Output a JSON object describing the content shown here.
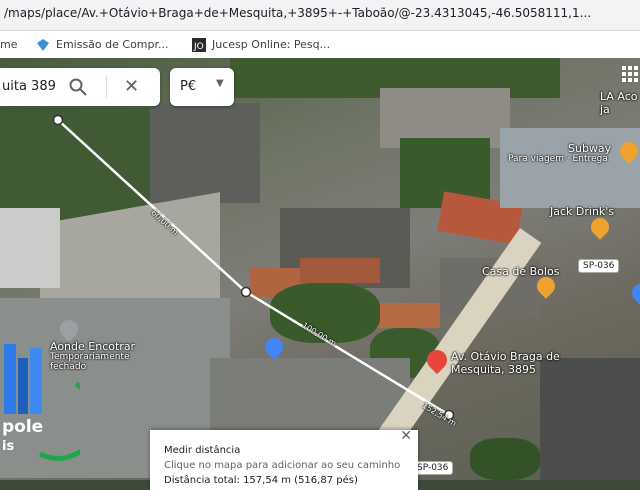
{
  "browser": {
    "url": "/maps/place/Av.+Otávio+Braga+de+Mesquita,+3895+-+Taboão/@-23.4313045,-46.5058111,1...",
    "bookmarks": [
      {
        "label": "me"
      },
      {
        "label": "Emissão de Compr..."
      },
      {
        "label": "Jucesp Online: Pesq..."
      }
    ]
  },
  "search": {
    "value": "uita 389",
    "filter_label": "P€"
  },
  "places": [
    {
      "label": "LA Aco",
      "label2": "ja"
    },
    {
      "label": "Subway",
      "sub": "Para viagem · Entrega"
    },
    {
      "label": "Jack Drink's"
    },
    {
      "label": "Casa de Bolos"
    },
    {
      "label": "Aonde Encotrar",
      "sub": "Temporariamente",
      "sub2": "fechado"
    },
    {
      "label": "Av. Otávio Braga de",
      "label2": "Mesquita, 3895"
    }
  ],
  "road_shields": [
    "SP-036",
    "SP-036"
  ],
  "measurements": [
    "60,00 m",
    "100,00 m",
    "152,54 m"
  ],
  "measure_panel": {
    "title": "Medir distância",
    "hint": "Clique no mapa para adicionar ao seu caminho",
    "total": "Distância total: 157,54 m (516,87 pés)"
  },
  "logo": {
    "text1": "pole",
    "text2": "is"
  },
  "colors": {
    "destination_pin": "#e8453c",
    "place_pin": "#f0a22e",
    "route": "#ffffff"
  }
}
